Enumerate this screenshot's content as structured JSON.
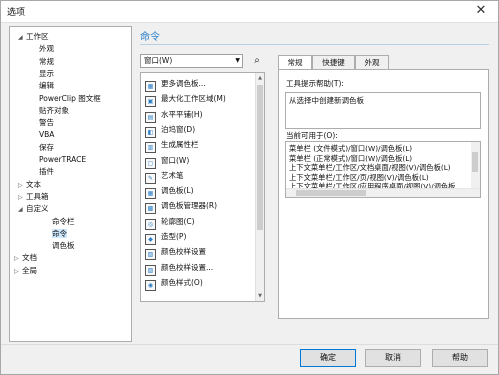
{
  "window": {
    "title": "选项",
    "close": "✕"
  },
  "tree": [
    {
      "label": "工作区",
      "tw": "◢"
    },
    {
      "label": "外观",
      "tw": ""
    },
    {
      "label": "常规",
      "tw": ""
    },
    {
      "label": "显示",
      "tw": ""
    },
    {
      "label": "编辑",
      "tw": ""
    },
    {
      "label": "PowerClip 图文框",
      "tw": ""
    },
    {
      "label": "贴齐对象",
      "tw": ""
    },
    {
      "label": "警告",
      "tw": ""
    },
    {
      "label": "VBA",
      "tw": ""
    },
    {
      "label": "保存",
      "tw": ""
    },
    {
      "label": "PowerTRACE",
      "tw": ""
    },
    {
      "label": "插件",
      "tw": ""
    },
    {
      "label": "文本",
      "tw": "▷"
    },
    {
      "label": "工具箱",
      "tw": "▷"
    },
    {
      "label": "自定义",
      "tw": "◢"
    },
    {
      "label": "命令栏",
      "tw": ""
    },
    {
      "label": "命令",
      "tw": "",
      "selected": true
    },
    {
      "label": "调色板",
      "tw": ""
    },
    {
      "label": "文档",
      "tw": "▷"
    },
    {
      "label": "全局",
      "tw": "▷"
    }
  ],
  "section_title": "命令",
  "category_select": {
    "value": "窗口(W)"
  },
  "commands": [
    {
      "label": "更多调色板...",
      "icon": "palette-icon"
    },
    {
      "label": "最大化工作区域(M)",
      "icon": "maximize-icon"
    },
    {
      "label": "水平平铺(H)",
      "icon": "tile-horizontal-icon"
    },
    {
      "label": "泊坞窗(D)",
      "icon": "docker-icon"
    },
    {
      "label": "生成属性栏",
      "icon": "property-bar-icon"
    },
    {
      "label": "窗口(W)",
      "icon": "window-icon"
    },
    {
      "label": "艺术笔",
      "icon": "art-pen-icon"
    },
    {
      "label": "调色板(L)",
      "icon": "color-palette-icon"
    },
    {
      "label": "调色板管理器(R)",
      "icon": "palette-manager-icon"
    },
    {
      "label": "轮廓图(C)",
      "icon": "contour-icon"
    },
    {
      "label": "造型(P)",
      "icon": "shaping-icon"
    },
    {
      "label": "颜色校样设置",
      "icon": "color-proof-icon"
    },
    {
      "label": "颜色校样设置...",
      "icon": "color-proof-settings-icon"
    },
    {
      "label": "颜色样式(O)",
      "icon": "color-styles-icon"
    }
  ],
  "tabs": [
    {
      "label": "常规",
      "active": true
    },
    {
      "label": "快捷键",
      "active": false
    },
    {
      "label": "外观",
      "active": false
    }
  ],
  "general": {
    "tip_label": "工具提示帮助(T):",
    "tip_value": "从选择中创建新调色板",
    "used_label": "当前可用于(O):",
    "used_in": [
      "菜单栏 (文件模式)/窗口(W)/调色板(L)",
      "菜单栏 (正常模式)/窗口(W)/调色板(L)",
      "上下文菜单栏/工作区/文档桌面/视图(V)/调色板(L)",
      "上下文菜单栏/工作区/页/视图(V)/调色板(L)",
      "上下文菜单栏/工作区/应用程序桌面/视图(V)/调色板"
    ]
  },
  "buttons": {
    "ok": "确定",
    "cancel": "取消",
    "help": "帮助"
  }
}
